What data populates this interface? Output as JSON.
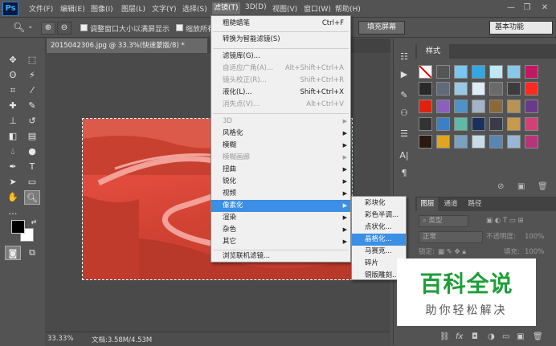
{
  "app": {
    "logo": "Ps"
  },
  "menubar": {
    "items": [
      "文件(F)",
      "编辑(E)",
      "图像(I)",
      "图层(L)",
      "文字(Y)",
      "选择(S)",
      "滤镜(T)",
      "3D(D)",
      "视图(V)",
      "窗口(W)",
      "帮助(H)"
    ],
    "active": "滤镜(T)"
  },
  "window_controls": [
    "minimize",
    "restore",
    "close"
  ],
  "options": {
    "checkbox1": "调整窗口大小以满屏显示",
    "checkbox2": "缩放所有",
    "fill_screen": "填充屏幕",
    "workspace": "基本功能"
  },
  "document": {
    "tab_title": "2015042306.jpg @ 33.3%(快速蒙版/8) *",
    "zoom": "33.33%",
    "doc_size": "文档:3.58M/4.53M"
  },
  "styles_panel": {
    "tab": "样式"
  },
  "layers_panel": {
    "tabs": [
      "图层",
      "通道",
      "路径"
    ],
    "kind_label": "类型",
    "blend_mode": "正常",
    "opacity_label": "不透明度:",
    "opacity_value": "100%",
    "lock_label": "锁定:",
    "fill_label": "填充:",
    "fill_value": "100%"
  },
  "filter_menu": {
    "items": [
      {
        "label": "粗糙蜡笔",
        "shortcut": "Ctrl+F",
        "disabled": false
      },
      {
        "label": "转换为智能滤镜(S)",
        "shortcut": "",
        "disabled": false
      },
      {
        "label": "滤镜库(G)...",
        "shortcut": "",
        "disabled": false
      },
      {
        "label": "自适应广角(A)...",
        "shortcut": "Alt+Shift+Ctrl+A",
        "disabled": true
      },
      {
        "label": "镜头校正(R)...",
        "shortcut": "Shift+Ctrl+R",
        "disabled": true
      },
      {
        "label": "液化(L)...",
        "shortcut": "Shift+Ctrl+X",
        "disabled": false
      },
      {
        "label": "消失点(V)...",
        "shortcut": "Alt+Ctrl+V",
        "disabled": true
      },
      {
        "label": "3D",
        "disabled": true,
        "submenu": true
      },
      {
        "label": "风格化",
        "submenu": true
      },
      {
        "label": "模糊",
        "submenu": true
      },
      {
        "label": "模糊画廊",
        "disabled": true,
        "submenu": true
      },
      {
        "label": "扭曲",
        "submenu": true
      },
      {
        "label": "锐化",
        "submenu": true
      },
      {
        "label": "视频",
        "submenu": true
      },
      {
        "label": "像素化",
        "submenu": true,
        "highlighted": true
      },
      {
        "label": "渲染",
        "submenu": true
      },
      {
        "label": "杂色",
        "submenu": true
      },
      {
        "label": "其它",
        "submenu": true
      },
      {
        "label": "浏览联机滤镜...",
        "shortcut": ""
      }
    ]
  },
  "pixelate_submenu": {
    "items": [
      "彩块化",
      "彩色半调...",
      "点状化...",
      "晶格化...",
      "马赛克...",
      "碎片",
      "铜版雕刻..."
    ],
    "highlighted": "晶格化..."
  },
  "watermark": {
    "title": "百科全说",
    "subtitle": "助你轻松解决"
  },
  "colors": {
    "menu_highlight": "#3b8fe4",
    "watermark_green": "#1e9e38",
    "image_tint": "#d84a3a"
  }
}
